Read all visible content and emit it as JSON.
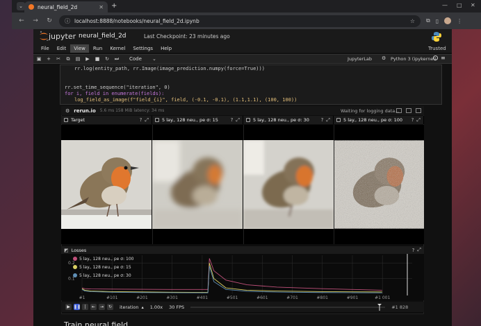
{
  "browser": {
    "tab_title": "neural_field_2d",
    "url": "localhost:8888/notebooks/neural_field_2d.ipynb"
  },
  "jupyter": {
    "logo_text": "jupyter",
    "notebook_name": "neural_field_2d",
    "checkpoint": "Last Checkpoint: 23 minutes ago",
    "menu": [
      "File",
      "Edit",
      "View",
      "Run",
      "Kernel",
      "Settings",
      "Help"
    ],
    "menu_active": "View",
    "trusted": "Trusted",
    "cell_type": "Code",
    "jupyterlab": "JupyterLab",
    "kernel": "Python 3 (ipykernel)",
    "brand_color": "#f37726"
  },
  "code": {
    "line1": "rr.log(entity_path, rr.Image(image_prediction.numpy(force=True)))",
    "line2": "rr.set_time_sequence(\"iteration\", 0)",
    "line3": "for i, field in enumerate(fields):",
    "line4": "log_field_as_image(f\"field_{i}\", field, (-0.1, -0.1), (1.1,1.1), (100, 100))"
  },
  "rerun": {
    "brand": "rerun.io",
    "stats": "5.6 ms   158 MiB   latency: 34 ms",
    "waiting": "Waiting for logging data...",
    "panels": [
      {
        "title": "Target"
      },
      {
        "title": "5 lay., 128 neu., pe σ: 15"
      },
      {
        "title": "5 lay., 128 neu., pe σ: 30"
      },
      {
        "title": "5 lay., 128 neu., pe σ: 100"
      }
    ],
    "losses_title": "Losses",
    "timeline": {
      "timeline_name": "iteration",
      "speed": "1.00x",
      "fps": "30 FPS",
      "frame": "#1 828"
    }
  },
  "chart_data": {
    "type": "line",
    "title": "Losses",
    "xlabel": "",
    "ylabel": "",
    "x_ticks": [
      "#1",
      "#101",
      "#201",
      "#301",
      "#401",
      "#501",
      "#601",
      "#701",
      "#801",
      "#901",
      "#1 001"
    ],
    "y_ticks": [
      0.1,
      0.2
    ],
    "xlim": [
      1,
      1100
    ],
    "ylim": [
      0,
      0.25
    ],
    "legend_position": "top-left",
    "series": [
      {
        "name": "5 lay., 128 neu., pe σ: 100",
        "color": "#c0507a",
        "x": [
          1,
          10,
          30,
          100,
          200,
          300,
          420,
          425,
          440,
          480,
          550,
          650,
          800,
          900,
          1000
        ],
        "y": [
          0.04,
          0.035,
          0.033,
          0.032,
          0.031,
          0.03,
          0.03,
          0.23,
          0.15,
          0.09,
          0.06,
          0.045,
          0.035,
          0.03,
          0.025
        ]
      },
      {
        "name": "5 lay., 128 neu., pe σ: 15",
        "color": "#d9cf63",
        "x": [
          1,
          10,
          30,
          100,
          200,
          300,
          420,
          425,
          440,
          480,
          550,
          650,
          800,
          900,
          1000
        ],
        "y": [
          0.035,
          0.025,
          0.02,
          0.016,
          0.014,
          0.012,
          0.011,
          0.2,
          0.1,
          0.04,
          0.025,
          0.02,
          0.016,
          0.015,
          0.014
        ]
      },
      {
        "name": "5 lay., 128 neu., pe σ: 30",
        "color": "#5f8fb5",
        "x": [
          1,
          10,
          30,
          100,
          200,
          300,
          420,
          425,
          440,
          480,
          550,
          650,
          800,
          900,
          1000
        ],
        "y": [
          0.03,
          0.02,
          0.016,
          0.012,
          0.01,
          0.009,
          0.008,
          0.18,
          0.08,
          0.03,
          0.018,
          0.013,
          0.01,
          0.009,
          0.008
        ]
      }
    ]
  },
  "output_heading": "Train neural field"
}
